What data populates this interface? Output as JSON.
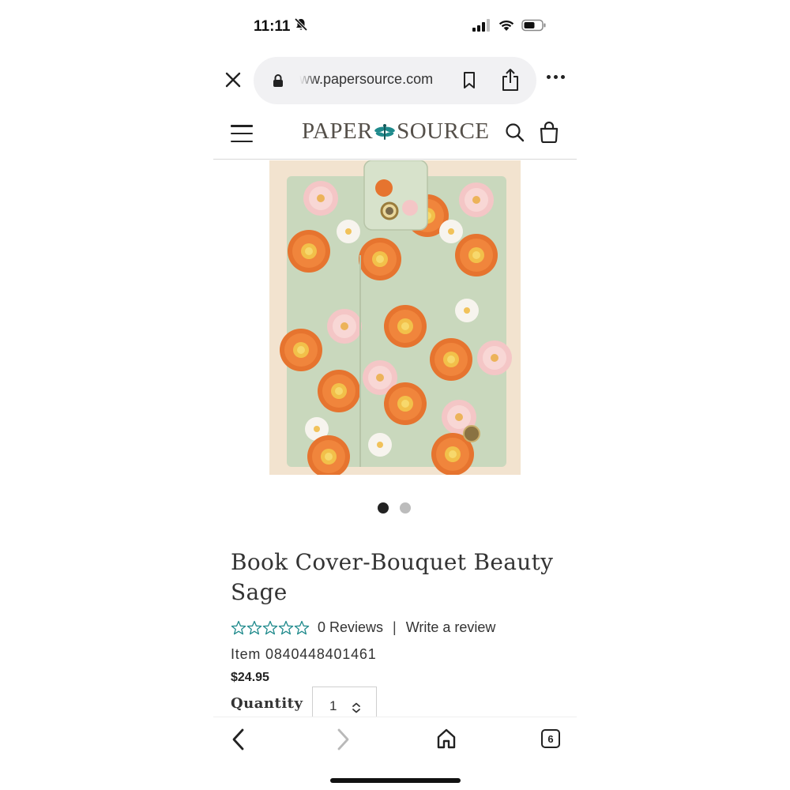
{
  "status_bar": {
    "time": "11:11",
    "icons": [
      "bell-slash-icon",
      "cellular-signal-icon",
      "wifi-icon",
      "battery-icon"
    ]
  },
  "browser": {
    "url": "ww.papersource.com",
    "icons": [
      "close-icon",
      "lock-icon",
      "bookmark-icon",
      "share-icon",
      "more-icon"
    ]
  },
  "site_header": {
    "logo_left": "PAPER",
    "logo_right": "SOURCE",
    "logo_accent_color": "#1f8a8c",
    "icons": [
      "menu-icon",
      "search-icon",
      "shopping-bag-icon"
    ]
  },
  "carousel": {
    "image_count": 2,
    "active_index": 0
  },
  "product": {
    "title": "Book Cover-Bouquet Beauty Sage",
    "rating_stars": 0,
    "reviews": "0 Reviews",
    "separator": "|",
    "write_review": "Write a review",
    "item_number": "Item 0840448401461",
    "price": "$24.95",
    "quantity_label": "Quantity",
    "quantity_value": "1",
    "star_color": "#1f8a8c"
  },
  "bottom_toolbar": {
    "tab_count": "6",
    "icons": [
      "back-icon",
      "forward-icon",
      "home-icon",
      "tabs-icon"
    ]
  }
}
